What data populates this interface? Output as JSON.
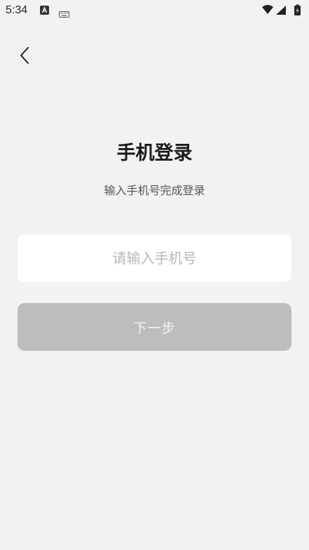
{
  "status_bar": {
    "time": "5:34",
    "left_icons": [
      "android-notification-icon",
      "keyboard-icon"
    ],
    "right_icons": [
      "wifi-icon",
      "signal-icon",
      "battery-icon"
    ]
  },
  "header": {
    "back_icon": "chevron-left-icon"
  },
  "main": {
    "title": "手机登录",
    "subtitle": "输入手机号完成登录",
    "phone_input": {
      "value": "",
      "placeholder": "请输入手机号"
    },
    "next_button_label": "下一步"
  },
  "colors": {
    "background": "#f2f2f2",
    "input_background": "#ffffff",
    "button_disabled": "#bdbdbd",
    "button_text": "#f4f4f4",
    "placeholder": "#b8b8b8"
  }
}
